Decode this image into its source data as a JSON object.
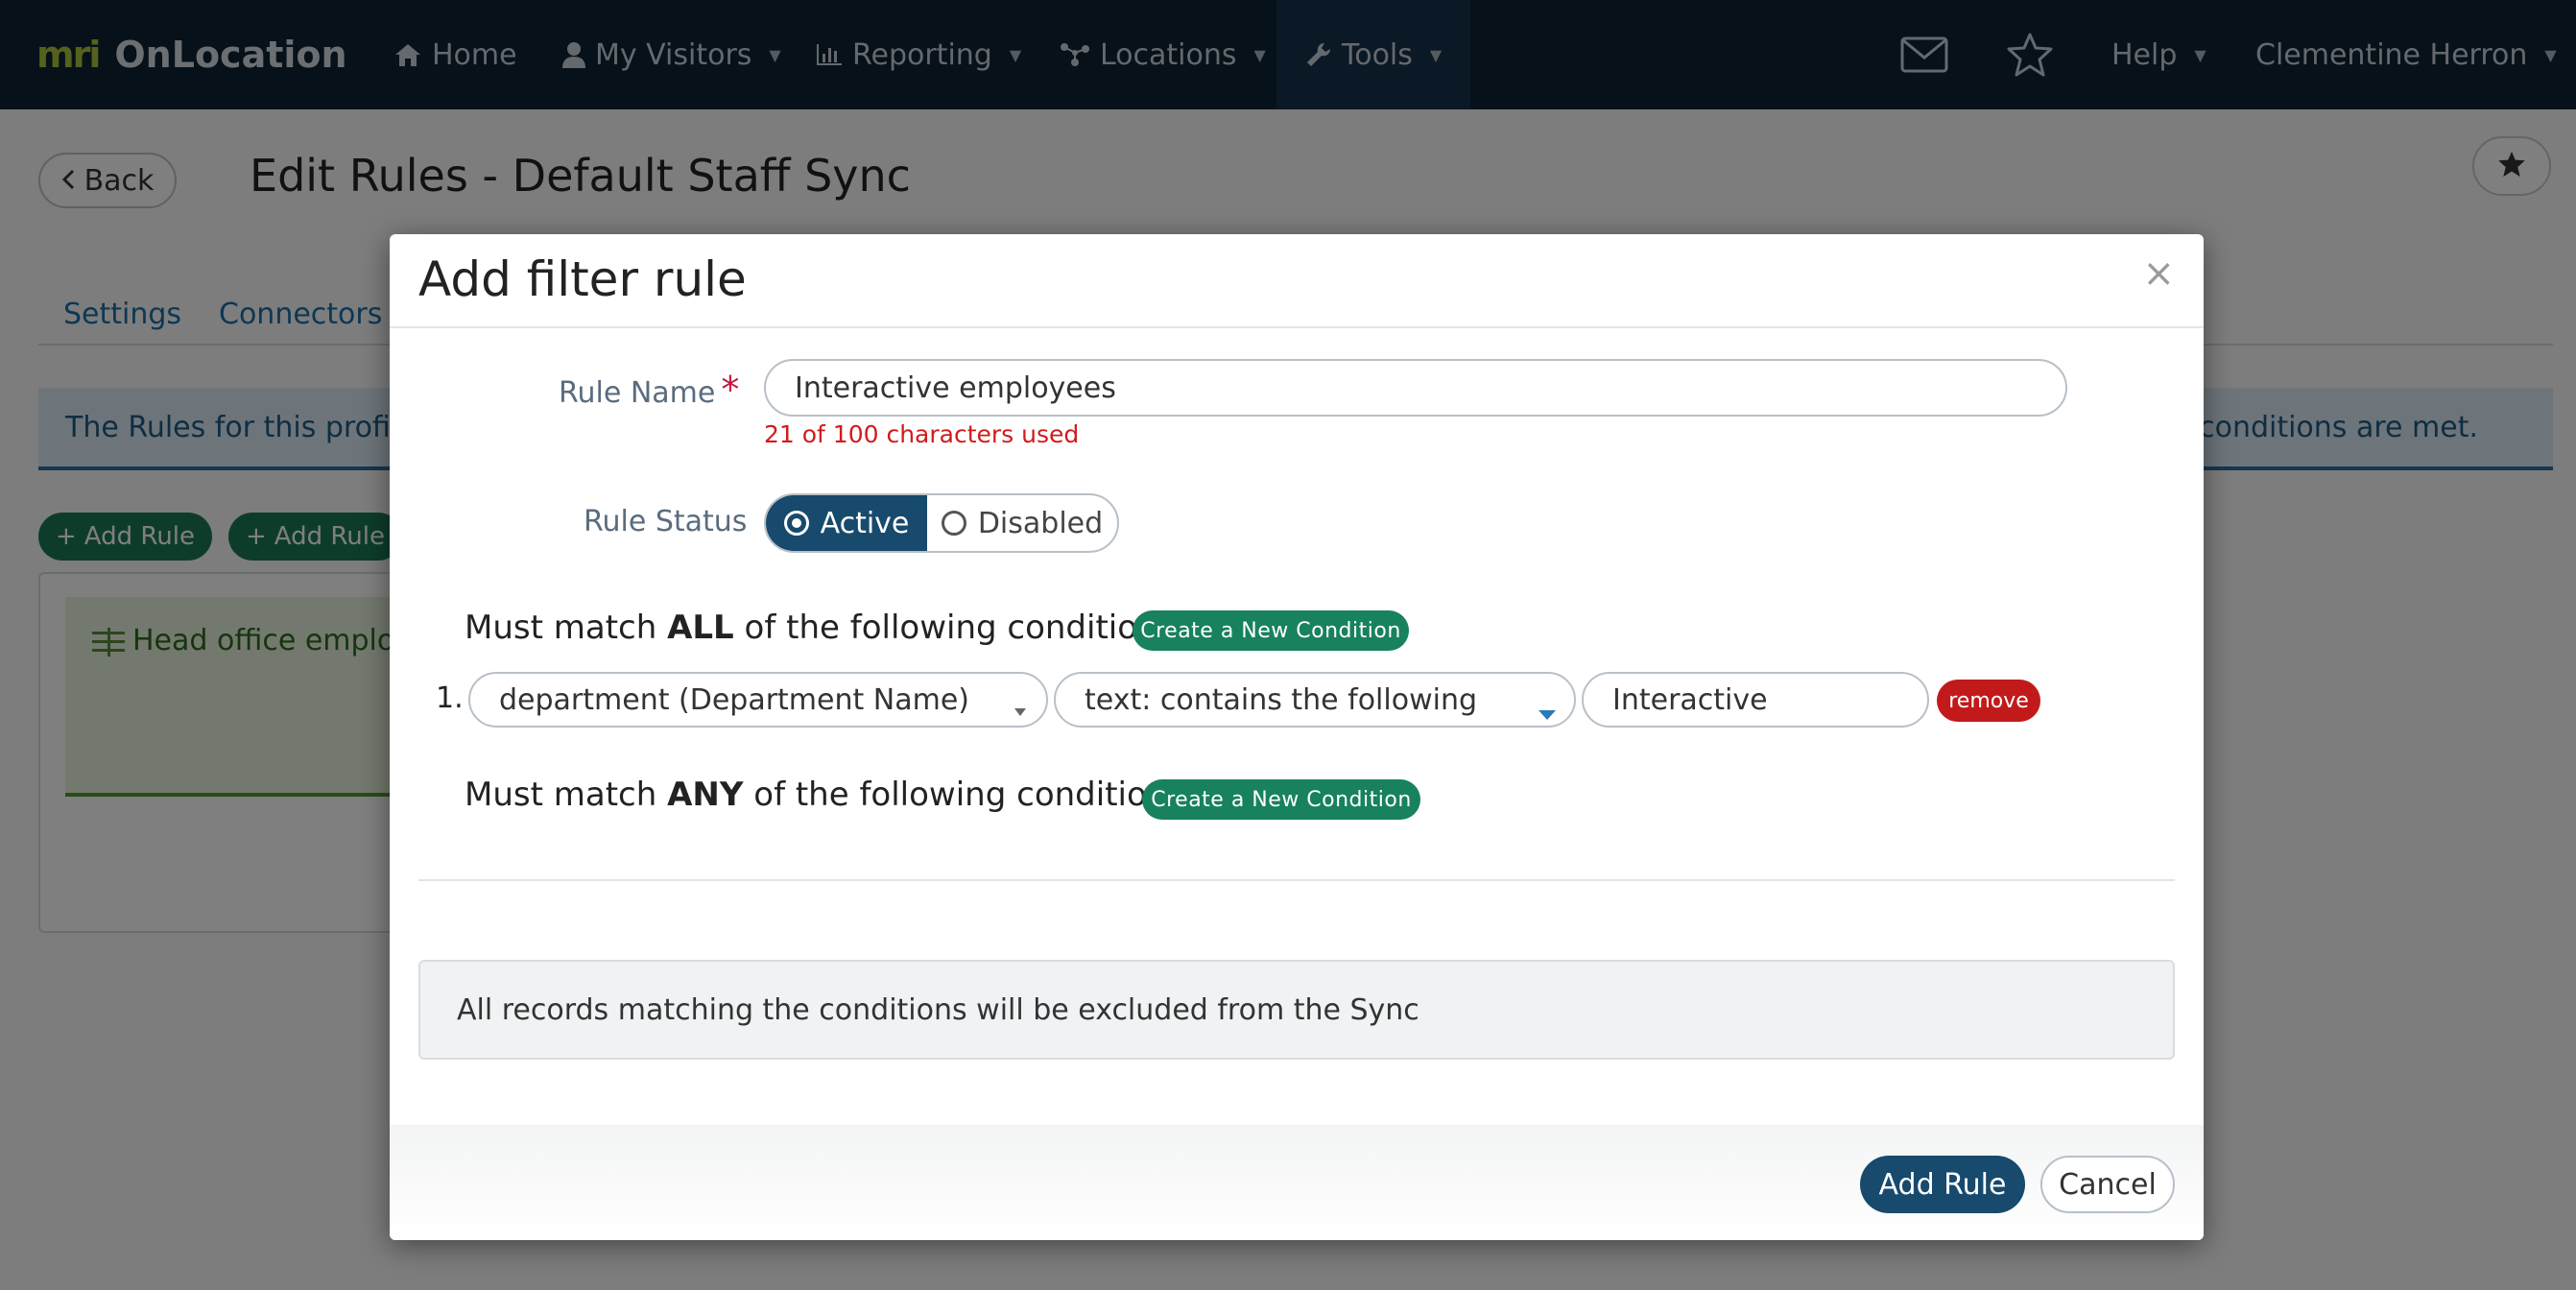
{
  "navbar": {
    "brand_logo": "mri",
    "brand_name": "OnLocation",
    "items": [
      {
        "label": "Home",
        "icon": "home-icon"
      },
      {
        "label": "My Visitors",
        "icon": "user-icon"
      },
      {
        "label": "Reporting",
        "icon": "bar-chart-icon"
      },
      {
        "label": "Locations",
        "icon": "network-icon"
      },
      {
        "label": "Tools",
        "icon": "wrench-icon"
      }
    ],
    "help_label": "Help",
    "user_name": "Clementine Herron"
  },
  "page": {
    "back_label": "Back",
    "title": "Edit Rules - Default Staff Sync",
    "tabs": [
      "Settings",
      "Connectors"
    ],
    "info_text_left": "The Rules for this profile a",
    "info_text_right": "p conditions are met.",
    "add_rule_label": "Add Rule",
    "add_rule_label_2": "Add Rule",
    "rule_card_label": "Head office employe"
  },
  "modal": {
    "title": "Add filter rule",
    "close_symbol": "×",
    "rule_name_label": "Rule Name",
    "required_mark": "*",
    "rule_name_value": "Interactive employees",
    "char_count_text": "21 of 100 characters used",
    "rule_status_label": "Rule Status",
    "status_active": "Active",
    "status_disabled": "Disabled",
    "all_prefix": "Must match ",
    "all_keyword": "ALL",
    "all_suffix": " of the following conditions",
    "any_prefix": "Must match ",
    "any_keyword": "ANY",
    "any_suffix": " of the following conditions",
    "create_condition_label": "Create a New Condition",
    "conditions": [
      {
        "number": "1.",
        "field": "department (Department Name)",
        "operator": "text: contains the following",
        "value": "Interactive",
        "remove_label": "remove"
      }
    ],
    "notice": "All records matching the conditions will be excluded from the Sync",
    "submit_label": "Add Rule",
    "cancel_label": "Cancel"
  },
  "colors": {
    "navbar_bg": "#0d2233",
    "primary": "#174a6c",
    "create_button": "#17825d",
    "remove_button": "#c21a1a",
    "error_text": "#d21b1b"
  }
}
